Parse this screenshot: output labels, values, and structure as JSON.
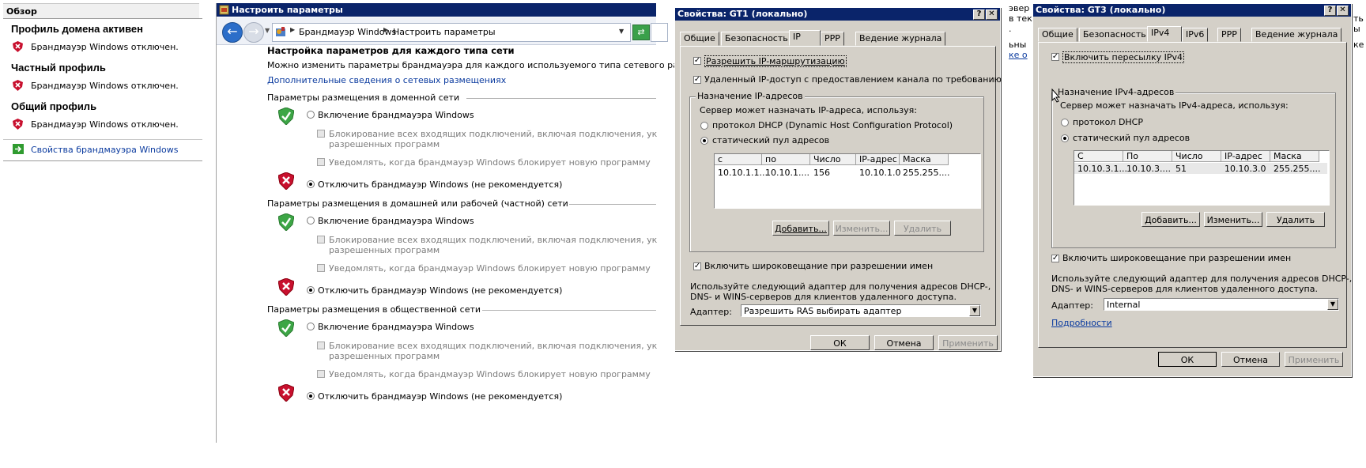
{
  "overview": {
    "header": "Обзор",
    "profiles": [
      {
        "title": "Профиль домена активен",
        "status": "Брандмауэр Windows отключен."
      },
      {
        "title": "Частный профиль",
        "status": "Брандмауэр Windows отключен."
      },
      {
        "title": "Общий профиль",
        "status": "Брандмауэр Windows отключен."
      }
    ],
    "properties_link": "Свойства брандмауэра Windows"
  },
  "customize": {
    "window_title": "Настроить параметры",
    "breadcrumb": [
      "Брандмауэр Windows",
      "Настроить параметры"
    ],
    "heading": "Настройка параметров для каждого типа сети",
    "description": "Можно изменить параметры брандмауэра для каждого используемого типа сетевого разм",
    "more_link": "Дополнительные сведения о сетевых размещениях",
    "sections": [
      {
        "title": "Параметры размещения в доменной сети"
      },
      {
        "title": "Параметры размещения в домашней или рабочей (частной) сети"
      },
      {
        "title": "Параметры размещения в общественной сети"
      }
    ],
    "enable_label": "Включение брандмауэра Windows",
    "block_label_1": "Блокирование всех входящих подключений, включая подключения, ук",
    "block_label_2": "разрешенных программ",
    "notify_label": "Уведомлять, когда брандмауэр Windows блокирует новую программу",
    "disable_label": "Отключить брандмауэр Windows (не рекомендуется)"
  },
  "gt1": {
    "title": "Свойства: GT1 (локально)",
    "tabs": [
      "Общие",
      "Безопасность",
      "IP",
      "PPP",
      "Ведение журнала"
    ],
    "selected_tab": "IP",
    "enable_routing": "Разрешить IP-маршрутизацию",
    "remote_access": "Удаленный IP-доступ с предоставлением канала по требованию",
    "group_title": "Назначение IP-адресов",
    "server_text": "Сервер может назначать IP-адреса, используя:",
    "dhcp_option": "протокол DHCP (Dynamic Host Configuration Protocol)",
    "static_option": "статический пул адресов",
    "columns": [
      "с",
      "по",
      "Число",
      "IP-адрес",
      "Маска"
    ],
    "rows": [
      [
        "10.10.1.1...",
        "10.10.1....",
        "156",
        "10.10.1.0",
        "255.255...."
      ]
    ],
    "add_btn": "Добавить...",
    "edit_btn": "Изменить...",
    "delete_btn": "Удалить",
    "broadcast": "Включить широковещание при разрешении имен",
    "adapter_text_1": "Используйте следующий адаптер для получения адресов DHCP-,",
    "adapter_text_2": "DNS- и WINS-серверов для клиентов удаленного доступа.",
    "adapter_label": "Адаптер:",
    "adapter_value": "Разрешить RAS выбирать адаптер",
    "ok": "ОК",
    "cancel": "Отмена",
    "apply": "Применить"
  },
  "bg_fragments": [
    "эвер",
    "в тек",
    ".",
    "ьны",
    "ке о",
    "ть",
    "ы",
    "ке"
  ],
  "gt3": {
    "title": "Свойства: GT3 (локально)",
    "tabs": [
      "Общие",
      "Безопасность",
      "IPv4",
      "IPv6",
      "PPP",
      "Ведение журнала"
    ],
    "selected_tab": "IPv4",
    "enable_forwarding": "Включить пересылку IPv4",
    "group_title": "Назначение IPv4-адресов",
    "server_text": "Сервер может назначать IPv4-адреса, используя:",
    "dhcp_option": "протокол DHCP",
    "static_option": "статический пул адресов",
    "columns": [
      "С",
      "По",
      "Число",
      "IP-адрес",
      "Маска"
    ],
    "rows": [
      [
        "10.10.3.1...",
        "10.10.3....",
        "51",
        "10.10.3.0",
        "255.255...."
      ]
    ],
    "add_btn": "Добавить...",
    "edit_btn": "Изменить...",
    "delete_btn": "Удалить",
    "broadcast": "Включить широковещание при разрешении имен",
    "adapter_text_1": "Используйте следующий адаптер для получения адресов DHCP-,",
    "adapter_text_2": "DNS- и WINS-серверов для клиентов удаленного доступа.",
    "adapter_label": "Адаптер:",
    "adapter_value": "Internal",
    "details_link": "Подробности",
    "ok": "ОК",
    "cancel": "Отмена",
    "apply": "Применить"
  }
}
